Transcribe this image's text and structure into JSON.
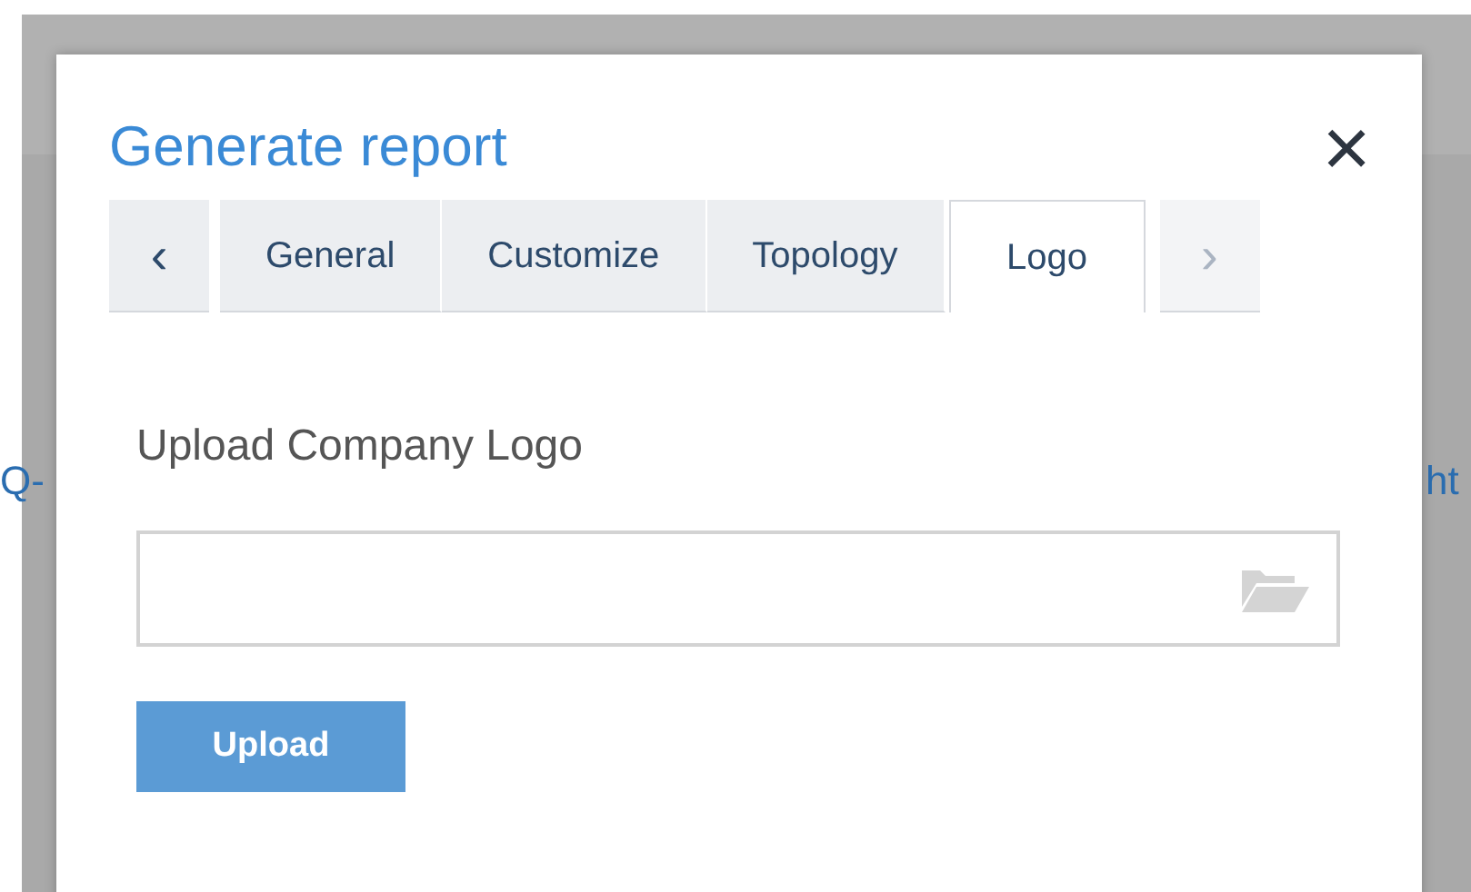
{
  "background": {
    "left_text": "Q-",
    "right_text": "ht"
  },
  "dialog": {
    "title": "Generate report",
    "close": "×"
  },
  "tabs": {
    "prev": {
      "label": "‹",
      "disabled": false
    },
    "next": {
      "label": "›",
      "disabled": true
    },
    "items": [
      {
        "label": "General",
        "selected": false
      },
      {
        "label": "Customize",
        "selected": false
      },
      {
        "label": "Topology",
        "selected": false
      },
      {
        "label": "Logo",
        "selected": true
      }
    ]
  },
  "upload": {
    "label": "Upload Company Logo",
    "button": "Upload"
  }
}
